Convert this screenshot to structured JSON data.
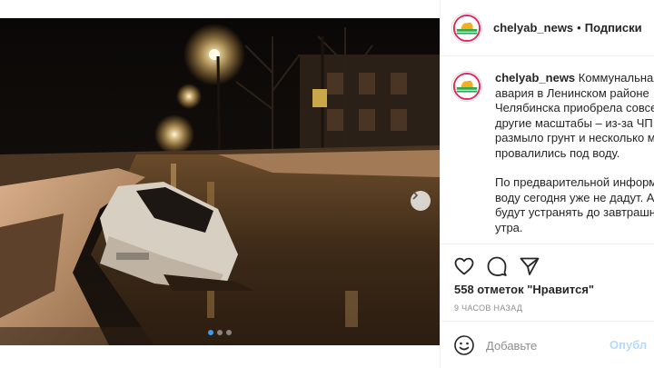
{
  "post": {
    "username": "chelyab_news",
    "separator": "•",
    "follow_label": "Подписки",
    "caption_lines": [
      "Коммунальная",
      "авария в Ленинском районе",
      "Челябинска приобрела совсе",
      "другие масштабы – из-за ЧП",
      "размыло грунт и несколько м",
      "провалились под воду."
    ],
    "caption_lines_2": [
      "По предварительной информ",
      "воду сегодня уже не дадут. А",
      "будут устранять до завтрашн",
      "утра."
    ],
    "likes_text": "558 отметок \"Нравится\"",
    "timestamp": "9 ЧАСОВ НАЗАД",
    "comment_placeholder": "Добавьте",
    "post_button": "Опубл"
  },
  "carousel": {
    "total_slides": 3,
    "active_slide": 1
  },
  "icons": {
    "like": "heart-icon",
    "comment": "comment-icon",
    "share": "share-icon",
    "emoji": "emoji-icon",
    "next": "chevron-right-icon"
  },
  "colors": {
    "link_disabled": "#b3dbff",
    "muted_text": "#8e8e8e",
    "border": "#efefef",
    "active_dot": "#3b9bf0"
  }
}
